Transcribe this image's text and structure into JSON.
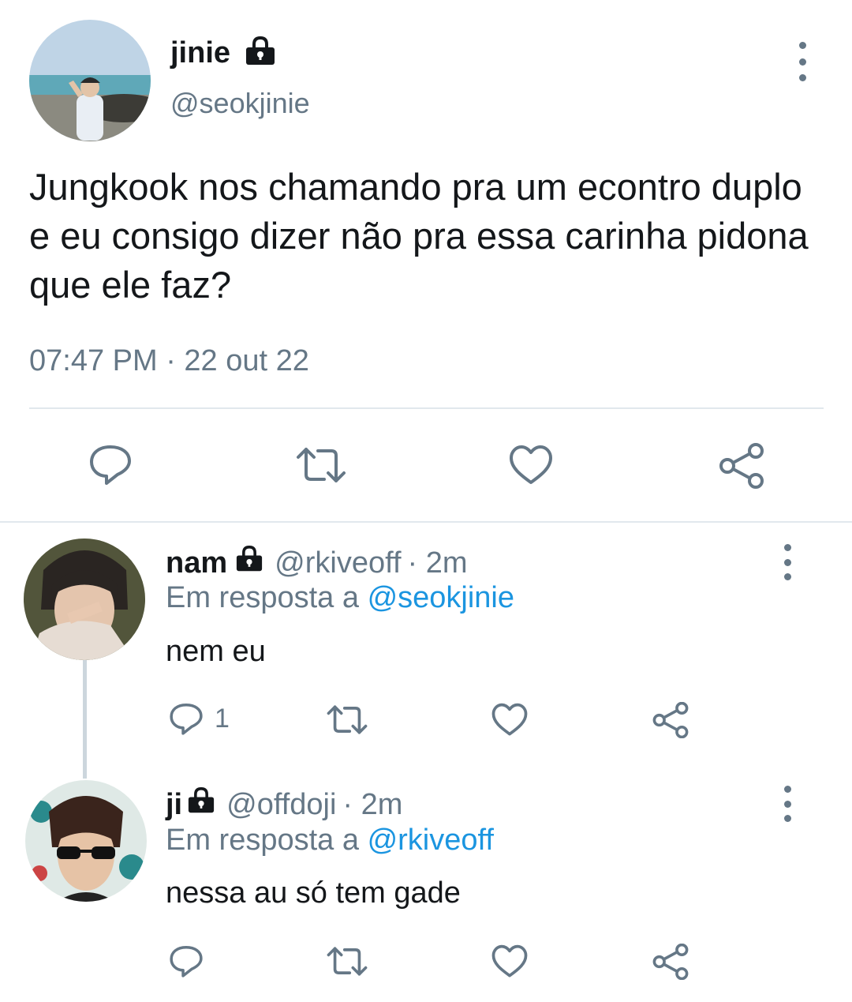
{
  "main_tweet": {
    "display_name": "jinie",
    "handle": "@seokjinie",
    "text": "Jungkook nos chamando pra um econtro duplo e eu consigo dizer não pra essa carinha pidona que ele faz?",
    "timestamp": "07:47 PM · 22 out 22",
    "avatar_icon": "avatar-photo",
    "lock_icon": "lock-icon",
    "actions": [
      "reply-icon",
      "retweet-icon",
      "like-icon",
      "share-icon"
    ]
  },
  "replies": [
    {
      "display_name": "nam",
      "handle": "@rkiveoff",
      "time": "· 2m",
      "in_reply_prefix": "Em resposta a",
      "in_reply_to": "@seokjinie",
      "text": "nem eu",
      "reply_count": "1"
    },
    {
      "display_name": "ji",
      "handle": "@offdoji",
      "time": "· 2m",
      "in_reply_prefix": "Em resposta a",
      "in_reply_to": "@rkiveoff",
      "text": "nessa au só tem gade",
      "reply_count": ""
    }
  ],
  "colors": {
    "text": "#14171a",
    "secondary": "#657786",
    "link": "#1b95e0",
    "divider": "#e1e8ed"
  }
}
